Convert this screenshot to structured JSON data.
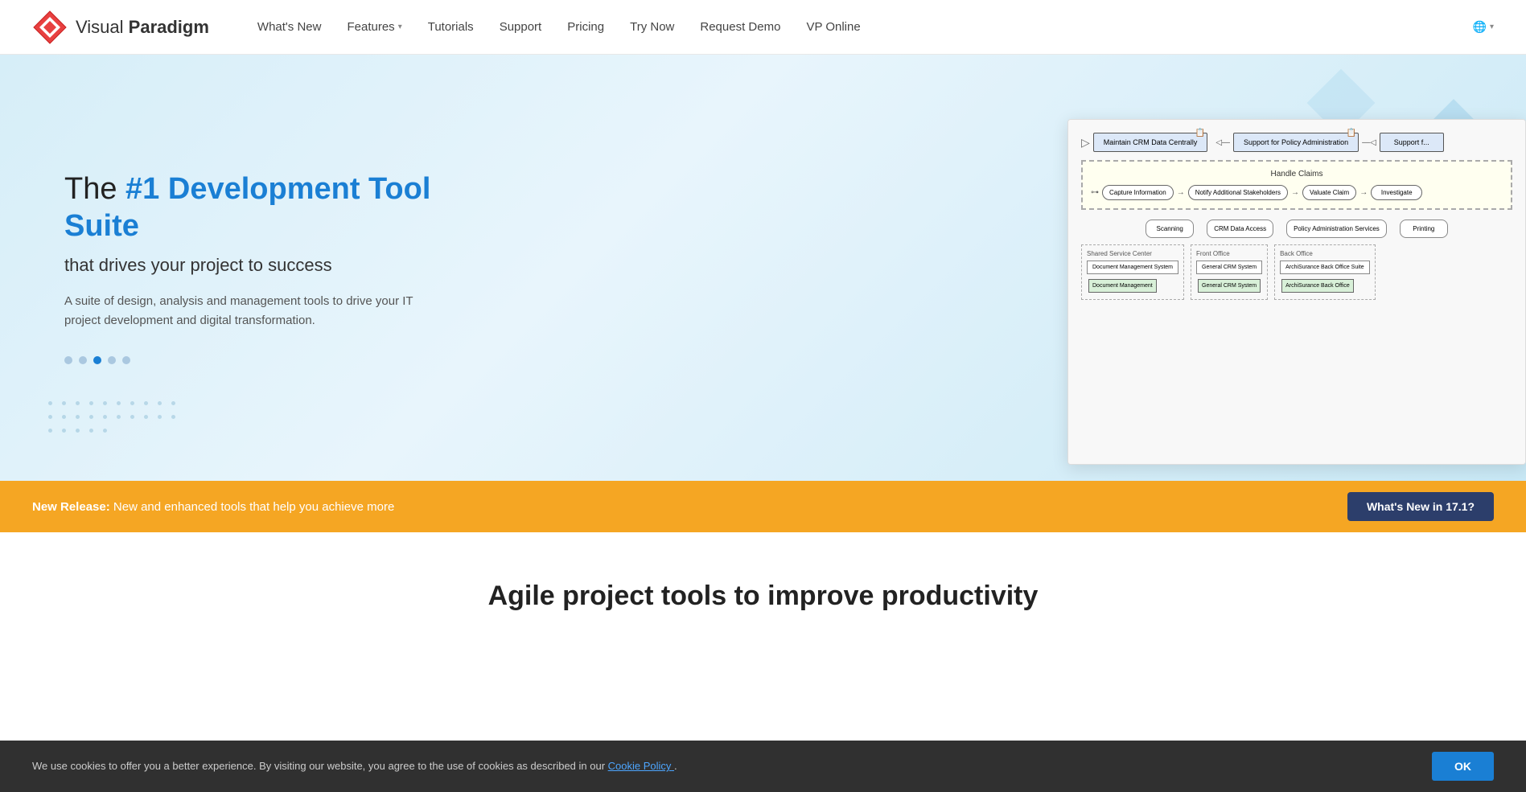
{
  "navbar": {
    "logo_text_1": "Visual",
    "logo_text_2": "Paradigm",
    "links": [
      {
        "label": "What's New",
        "has_dropdown": false,
        "id": "whats-new"
      },
      {
        "label": "Features",
        "has_dropdown": true,
        "id": "features"
      },
      {
        "label": "Tutorials",
        "has_dropdown": false,
        "id": "tutorials"
      },
      {
        "label": "Support",
        "has_dropdown": false,
        "id": "support"
      },
      {
        "label": "Pricing",
        "has_dropdown": false,
        "id": "pricing"
      },
      {
        "label": "Try Now",
        "has_dropdown": false,
        "id": "try-now"
      },
      {
        "label": "Request Demo",
        "has_dropdown": false,
        "id": "request-demo"
      },
      {
        "label": "VP Online",
        "has_dropdown": false,
        "id": "vp-online"
      }
    ],
    "globe_icon": "🌐"
  },
  "hero": {
    "title_prefix": "The ",
    "title_highlight": "#1 Development Tool Suite",
    "subtitle": "that drives your project to success",
    "description": "A suite of design, analysis and management tools to drive your IT project development and digital transformation.",
    "dots": [
      {
        "active": false
      },
      {
        "active": false
      },
      {
        "active": true
      },
      {
        "active": false
      },
      {
        "active": false
      }
    ]
  },
  "diagram": {
    "box1": "Maintain CRM Data Centrally",
    "box2": "Support for Policy Administration",
    "box3": "Support f...",
    "handle_claims_label": "Handle Claims",
    "proc1": "Capture Information",
    "proc2": "Notify Additional Stakeholders",
    "proc3": "Valuate Claim",
    "proc4": "Investigate",
    "svc1": "Scanning",
    "svc2": "CRM Data Access",
    "svc3": "Policy Administration Services",
    "svc4": "Printing",
    "zone1_label": "Shared Service Center",
    "zone2_label": "Front Office",
    "zone3_label": "Back Office",
    "comp1": "Document Management System",
    "comp2": "General CRM System",
    "comp3": "ArchiSurance Back Office Suite",
    "comp4": "Document Management",
    "comp5": "General CRM System",
    "comp6": "ArchiSurance Back Office"
  },
  "banner": {
    "label": "New Release:",
    "text": " New and enhanced tools that help you achieve more",
    "button_label": "What's New in 17.1?"
  },
  "agile": {
    "title": "Agile project tools to improve productivity"
  },
  "cookie": {
    "text": "We use cookies to offer you a better experience. By visiting our website, you agree to the use of cookies as described in our ",
    "link_text": "Cookie Policy",
    "text_after": ".",
    "button_label": "OK"
  }
}
